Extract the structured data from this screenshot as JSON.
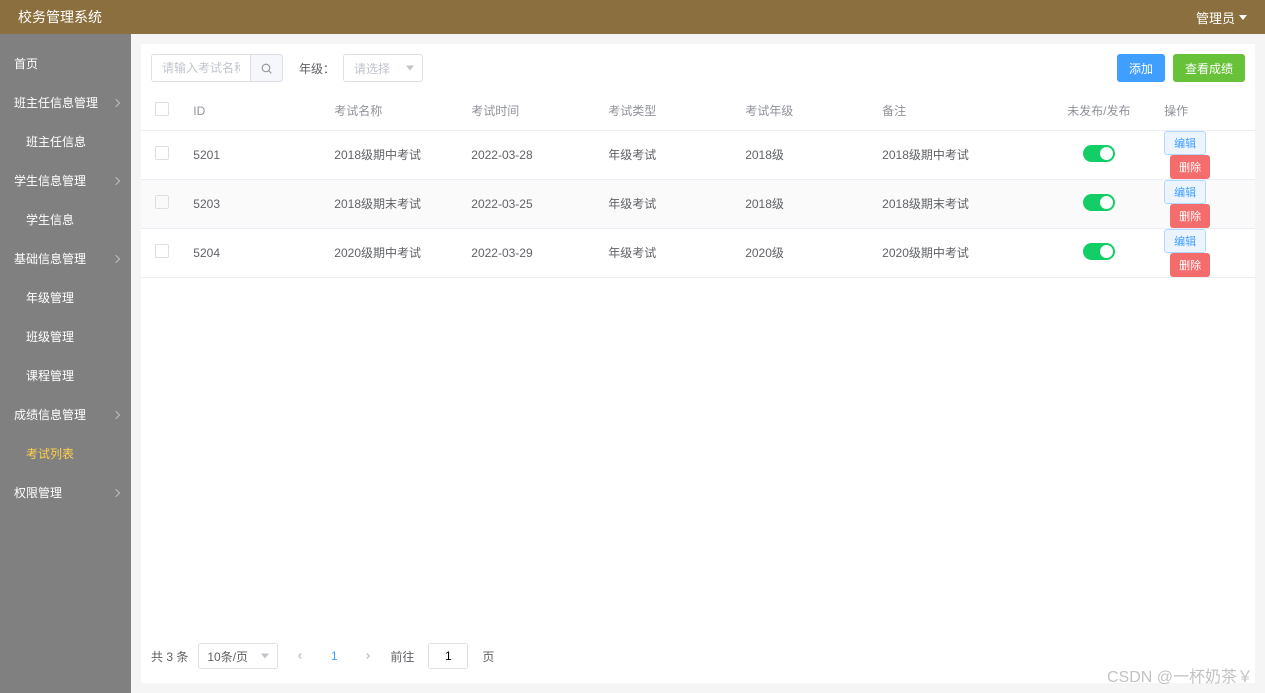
{
  "header": {
    "title": "校务管理系统",
    "user": "管理员"
  },
  "sidebar": {
    "items": [
      {
        "label": "首页",
        "sub": false
      },
      {
        "label": "班主任信息管理",
        "sub": false,
        "hasSub": true
      },
      {
        "label": "班主任信息",
        "sub": true
      },
      {
        "label": "学生信息管理",
        "sub": false,
        "hasSub": true
      },
      {
        "label": "学生信息",
        "sub": true
      },
      {
        "label": "基础信息管理",
        "sub": false,
        "hasSub": true
      },
      {
        "label": "年级管理",
        "sub": true
      },
      {
        "label": "班级管理",
        "sub": true
      },
      {
        "label": "课程管理",
        "sub": true
      },
      {
        "label": "成绩信息管理",
        "sub": false,
        "hasSub": true
      },
      {
        "label": "考试列表",
        "sub": true,
        "active": true
      },
      {
        "label": "权限管理",
        "sub": false,
        "hasSub": true
      }
    ]
  },
  "toolbar": {
    "search_placeholder": "请输入考试名称",
    "grade_label": "年级：",
    "grade_placeholder": "请选择",
    "add_label": "添加",
    "view_label": "查看成绩"
  },
  "table": {
    "headers": {
      "id": "ID",
      "name": "考试名称",
      "time": "考试时间",
      "type": "考试类型",
      "grade": "考试年级",
      "remark": "备注",
      "publish": "未发布/发布",
      "action": "操作"
    },
    "edit_label": "编辑",
    "delete_label": "删除",
    "rows": [
      {
        "id": "5201",
        "name": "2018级期中考试",
        "time": "2022-03-28",
        "type": "年级考试",
        "grade": "2018级",
        "remark": "2018级期中考试",
        "published": true
      },
      {
        "id": "5203",
        "name": "2018级期末考试",
        "time": "2022-03-25",
        "type": "年级考试",
        "grade": "2018级",
        "remark": "2018级期末考试",
        "published": true
      },
      {
        "id": "5204",
        "name": "2020级期中考试",
        "time": "2022-03-29",
        "type": "年级考试",
        "grade": "2020级",
        "remark": "2020级期中考试",
        "published": true
      }
    ]
  },
  "pagination": {
    "total_text": "共 3 条",
    "pagesize_text": "10条/页",
    "current": "1",
    "goto_prefix": "前往",
    "goto_value": "1",
    "goto_suffix": "页"
  },
  "watermark": "CSDN @一杯奶茶￥"
}
